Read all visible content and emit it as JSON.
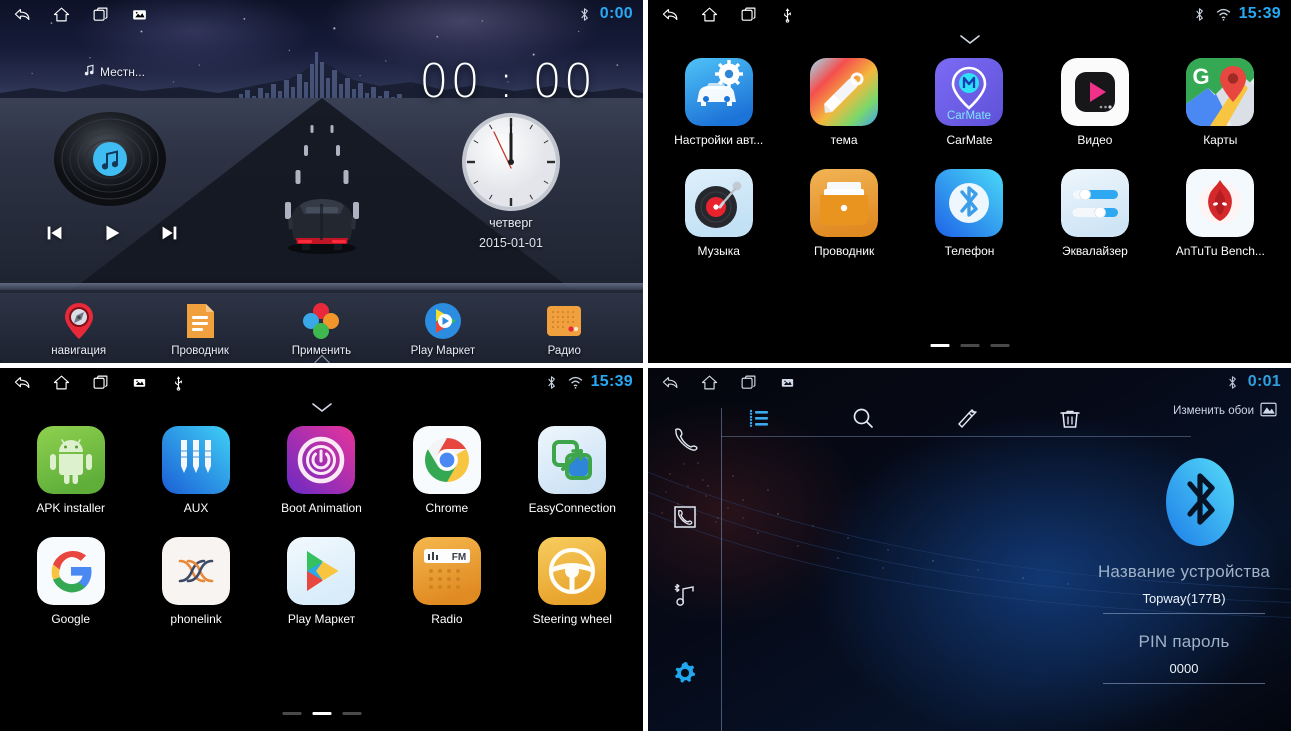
{
  "panel1": {
    "name": "car-head-unit-home-screen",
    "statusbar": {
      "icons": [
        "back-icon",
        "home-icon",
        "recents-icon",
        "gallery-icon"
      ],
      "right_icons": [
        "bluetooth-icon"
      ],
      "time": "0:00"
    },
    "media": {
      "source_label": "Местн...",
      "icon": "music-note-icon"
    },
    "controls": {
      "previous": "previous-track",
      "play": "play",
      "next": "next-track"
    },
    "clock": {
      "digital_time": "00 : 00",
      "weekday": "четверг",
      "date": "2015-01-01"
    },
    "dock": [
      {
        "label": "навигация",
        "icon": "navigation-pin-icon"
      },
      {
        "label": "Проводник",
        "icon": "file-explorer-icon"
      },
      {
        "label": "Применить",
        "icon": "apply-theme-icon"
      },
      {
        "label": "Play Маркет",
        "icon": "play-store-icon"
      },
      {
        "label": "Радио",
        "icon": "radio-icon"
      }
    ]
  },
  "panel2": {
    "name": "app-drawer-page-1",
    "statusbar": {
      "icons": [
        "back-icon",
        "home-icon",
        "recents-icon",
        "usb-icon"
      ],
      "right_icons": [
        "bluetooth-icon",
        "wifi-icon"
      ],
      "time": "15:39"
    },
    "apps": [
      {
        "label": "Настройки авт...",
        "icon": "car-settings-icon"
      },
      {
        "label": "тема",
        "icon": "theme-brush-icon"
      },
      {
        "label": "CarMate",
        "icon": "carmate-icon"
      },
      {
        "label": "Видео",
        "icon": "video-player-icon"
      },
      {
        "label": "Карты",
        "icon": "google-maps-icon"
      },
      {
        "label": "Музыка",
        "icon": "music-turntable-icon"
      },
      {
        "label": "Проводник",
        "icon": "file-manager-icon"
      },
      {
        "label": "Телефон",
        "icon": "bluetooth-phone-icon"
      },
      {
        "label": "Эквалайзер",
        "icon": "equalizer-icon"
      },
      {
        "label": "AnTuTu Bench...",
        "icon": "antutu-icon"
      }
    ],
    "page_indicator": {
      "count": 3,
      "active": 0
    }
  },
  "panel3": {
    "name": "app-drawer-page-2",
    "statusbar": {
      "icons": [
        "back-icon",
        "home-icon",
        "recents-icon",
        "gallery-icon",
        "usb-icon"
      ],
      "right_icons": [
        "bluetooth-icon",
        "wifi-icon"
      ],
      "time": "15:39"
    },
    "apps": [
      {
        "label": "APK installer",
        "icon": "android-apk-icon"
      },
      {
        "label": "AUX",
        "icon": "aux-jack-icon"
      },
      {
        "label": "Boot Animation",
        "icon": "power-boot-icon"
      },
      {
        "label": "Chrome",
        "icon": "chrome-icon"
      },
      {
        "label": "EasyConnection",
        "icon": "easyconnection-icon"
      },
      {
        "label": "Google",
        "icon": "google-icon"
      },
      {
        "label": "phonelink",
        "icon": "phonelink-icon"
      },
      {
        "label": "Play Маркет",
        "icon": "play-store-icon"
      },
      {
        "label": "Radio",
        "icon": "fm-radio-icon"
      },
      {
        "label": "Steering wheel",
        "icon": "steering-wheel-icon"
      }
    ],
    "page_indicator": {
      "count": 3,
      "active": 1
    }
  },
  "panel4": {
    "name": "bluetooth-settings-screen",
    "statusbar": {
      "icons": [
        "back-icon",
        "home-icon",
        "recents-icon",
        "gallery-icon"
      ],
      "right_icons": [
        "bluetooth-icon"
      ],
      "time": "0:01"
    },
    "sidebar": [
      {
        "icon": "phone-handset-icon"
      },
      {
        "icon": "contacts-phonebook-icon"
      },
      {
        "icon": "bluetooth-music-icon"
      },
      {
        "icon": "settings-gear-icon"
      }
    ],
    "toolbar": [
      {
        "icon": "list-icon"
      },
      {
        "icon": "search-icon"
      },
      {
        "icon": "edit-pen-icon"
      },
      {
        "icon": "trash-icon"
      }
    ],
    "change_wallpaper": {
      "label": "Изменить обои",
      "icon": "image-icon"
    },
    "bluetooth_icon": "bluetooth-logo-icon",
    "fields": [
      {
        "label": "Название устройства",
        "value": "Topway(177B)"
      },
      {
        "label": "PIN пароль",
        "value": "0000"
      }
    ]
  }
}
